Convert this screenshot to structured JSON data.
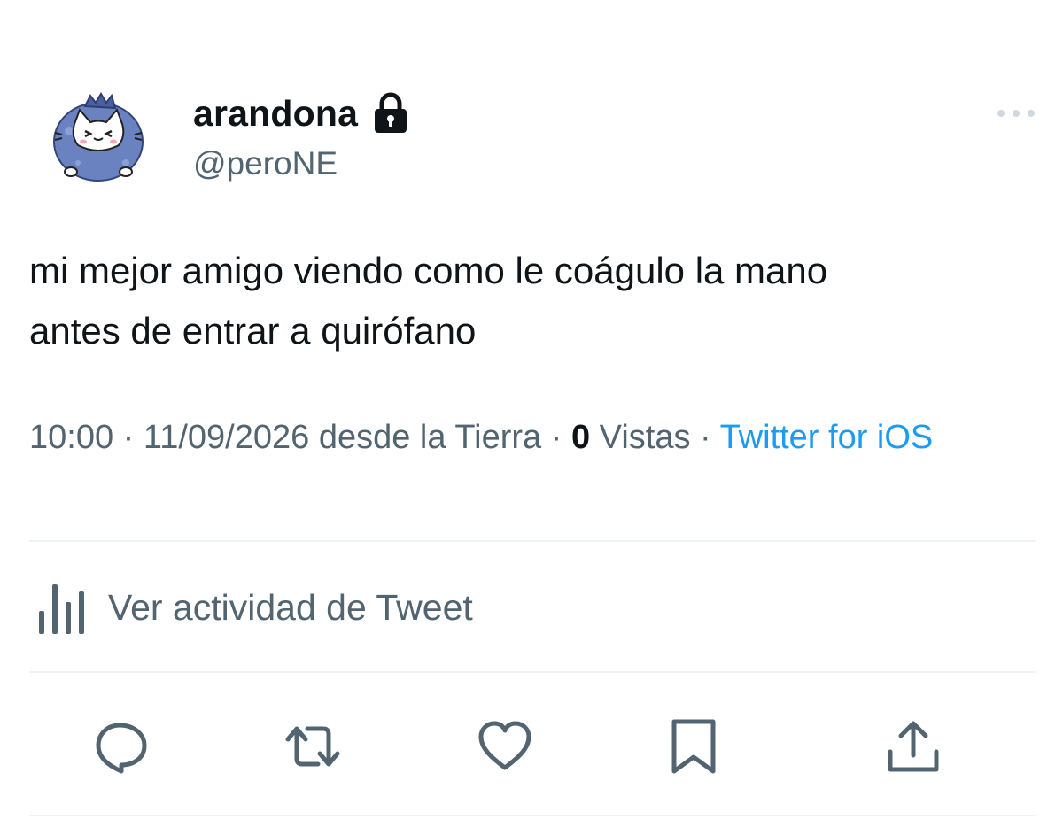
{
  "user": {
    "display_name": "arandona",
    "handle": "@peroNE",
    "avatar_icon": "blueberry-cat-avatar",
    "protected_icon": "lock-icon"
  },
  "tweet": {
    "text_line_1": "mi mejor amigo viendo como le coágulo la mano",
    "text_line_2": "antes de entrar a quirófano"
  },
  "meta": {
    "time": "10:00",
    "separator": " · ",
    "date": "11/09/2026",
    "location": "desde la Tierra",
    "views_count": "0",
    "views_label": "Vistas",
    "source": "Twitter for iOS"
  },
  "activity": {
    "label": "Ver actividad de Tweet",
    "icon": "analytics-icon"
  },
  "actions": {
    "reply_icon": "reply-icon",
    "retweet_icon": "retweet-icon",
    "like_icon": "heart-icon",
    "bookmark_icon": "bookmark-icon",
    "share_icon": "share-icon"
  },
  "colors": {
    "text_primary": "#0f1419",
    "text_secondary": "#536471",
    "accent": "#1d9bf0",
    "divider": "#eff3f4"
  }
}
